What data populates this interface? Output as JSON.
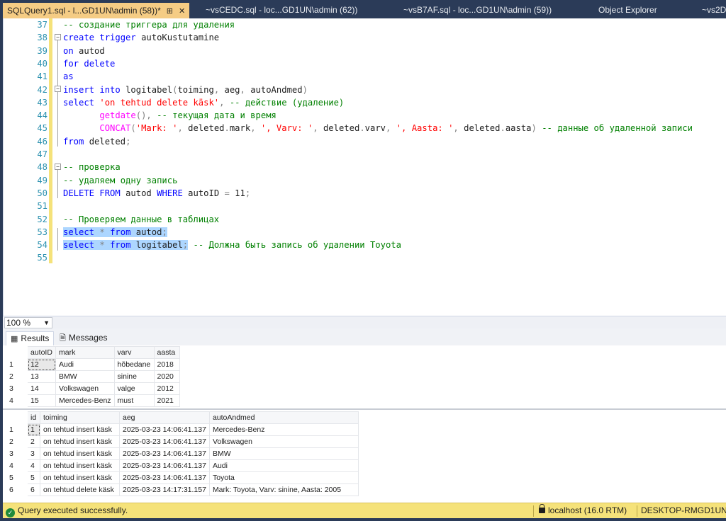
{
  "tabs": [
    {
      "label": "SQLQuery1.sql - l...GD1UN\\admin (58))*",
      "active": true
    },
    {
      "label": "~vsCEDC.sql - loc...GD1UN\\admin (62))"
    },
    {
      "label": "~vsB7AF.sql - loc...GD1UN\\admin (59))"
    },
    {
      "label": "Object Explorer"
    },
    {
      "label": "~vs2D"
    }
  ],
  "tab_icons": {
    "pin": "⊞",
    "close": "✕"
  },
  "editor": {
    "lines": [
      {
        "n": "37",
        "segs": [
          [
            "cm",
            "-- создание триггера для удаления"
          ]
        ]
      },
      {
        "n": "38",
        "segs": [
          [
            "kw",
            "create"
          ],
          [
            "tx",
            " "
          ],
          [
            "kw",
            "trigger"
          ],
          [
            "tx",
            " autoKustutamine"
          ]
        ]
      },
      {
        "n": "39",
        "segs": [
          [
            "kw",
            "on"
          ],
          [
            "tx",
            " autod"
          ]
        ]
      },
      {
        "n": "40",
        "segs": [
          [
            "kw",
            "for"
          ],
          [
            "tx",
            " "
          ],
          [
            "kw",
            "delete"
          ]
        ]
      },
      {
        "n": "41",
        "segs": [
          [
            "kw",
            "as"
          ]
        ]
      },
      {
        "n": "42",
        "segs": [
          [
            "kw",
            "insert"
          ],
          [
            "tx",
            " "
          ],
          [
            "kw",
            "into"
          ],
          [
            "tx",
            " logitabel"
          ],
          [
            "gr",
            "("
          ],
          [
            "tx",
            "toiming"
          ],
          [
            "gr",
            ","
          ],
          [
            "tx",
            " aeg"
          ],
          [
            "gr",
            ","
          ],
          [
            "tx",
            " autoAndmed"
          ],
          [
            "gr",
            ")"
          ]
        ]
      },
      {
        "n": "43",
        "segs": [
          [
            "kw",
            "select"
          ],
          [
            "tx",
            " "
          ],
          [
            "str",
            "'on tehtud delete käsk'"
          ],
          [
            "gr",
            ","
          ],
          [
            "tx",
            " "
          ],
          [
            "cm",
            "-- действие (удаление)"
          ]
        ]
      },
      {
        "n": "44",
        "segs": [
          [
            "tx",
            "       "
          ],
          [
            "fn",
            "getdate"
          ],
          [
            "gr",
            "(),"
          ],
          [
            "tx",
            " "
          ],
          [
            "cm",
            "-- текущая дата и время"
          ]
        ]
      },
      {
        "n": "45",
        "segs": [
          [
            "tx",
            "       "
          ],
          [
            "fn",
            "CONCAT"
          ],
          [
            "gr",
            "("
          ],
          [
            "str",
            "'Mark: '"
          ],
          [
            "gr",
            ","
          ],
          [
            "tx",
            " deleted"
          ],
          [
            "gr",
            "."
          ],
          [
            "tx",
            "mark"
          ],
          [
            "gr",
            ","
          ],
          [
            "tx",
            " "
          ],
          [
            "str",
            "', Varv: '"
          ],
          [
            "gr",
            ","
          ],
          [
            "tx",
            " deleted"
          ],
          [
            "gr",
            "."
          ],
          [
            "tx",
            "varv"
          ],
          [
            "gr",
            ","
          ],
          [
            "tx",
            " "
          ],
          [
            "str",
            "', Aasta: '"
          ],
          [
            "gr",
            ","
          ],
          [
            "tx",
            " deleted"
          ],
          [
            "gr",
            "."
          ],
          [
            "tx",
            "aasta"
          ],
          [
            "gr",
            ")"
          ],
          [
            "tx",
            " "
          ],
          [
            "cm",
            "-- данные об удаленной записи"
          ]
        ]
      },
      {
        "n": "46",
        "segs": [
          [
            "kw",
            "from"
          ],
          [
            "tx",
            " deleted"
          ],
          [
            "gr",
            ";"
          ]
        ]
      },
      {
        "n": "47",
        "segs": []
      },
      {
        "n": "48",
        "segs": [
          [
            "cm",
            "-- проверка"
          ]
        ]
      },
      {
        "n": "49",
        "segs": [
          [
            "cm",
            "-- удаляем одну запись"
          ]
        ]
      },
      {
        "n": "50",
        "segs": [
          [
            "kw",
            "DELETE"
          ],
          [
            "tx",
            " "
          ],
          [
            "kw",
            "FROM"
          ],
          [
            "tx",
            " autod "
          ],
          [
            "kw",
            "WHERE"
          ],
          [
            "tx",
            " autoID "
          ],
          [
            "gr",
            "="
          ],
          [
            "tx",
            " 11"
          ],
          [
            "gr",
            ";"
          ]
        ]
      },
      {
        "n": "51",
        "segs": []
      },
      {
        "n": "52",
        "segs": [
          [
            "cm",
            "-- Проверяем данные в таблицах"
          ]
        ]
      },
      {
        "n": "53",
        "segs": [
          [
            "kw",
            "select"
          ],
          [
            "tx",
            " "
          ],
          [
            "gr",
            "*"
          ],
          [
            "tx",
            " "
          ],
          [
            "kw",
            "from"
          ],
          [
            "tx",
            " autod"
          ],
          [
            "gr",
            ";"
          ]
        ],
        "sel": true
      },
      {
        "n": "54",
        "segs": [
          [
            "kw",
            "select"
          ],
          [
            "tx",
            " "
          ],
          [
            "gr",
            "*"
          ],
          [
            "tx",
            " "
          ],
          [
            "kw",
            "from"
          ],
          [
            "tx",
            " logitabel"
          ],
          [
            "gr",
            ";"
          ]
        ],
        "sel": true,
        "tail": [
          [
            "tx",
            " "
          ],
          [
            "cm",
            "-- Должна быть запись об удалении Toyota"
          ]
        ]
      },
      {
        "n": "55",
        "segs": []
      }
    ]
  },
  "zoom": {
    "value": "100 %"
  },
  "results_tabs": {
    "results": "Results",
    "messages": "Messages"
  },
  "grid1": {
    "columns": [
      "autoID",
      "mark",
      "varv",
      "aasta"
    ],
    "rows": [
      [
        "1",
        "12",
        "Audi",
        "hõbedane",
        "2018"
      ],
      [
        "2",
        "13",
        "BMW",
        "sinine",
        "2020"
      ],
      [
        "3",
        "14",
        "Volkswagen",
        "valge",
        "2012"
      ],
      [
        "4",
        "15",
        "Mercedes-Benz",
        "must",
        "2021"
      ]
    ]
  },
  "grid2": {
    "columns": [
      "id",
      "toiming",
      "aeg",
      "autoAndmed"
    ],
    "rows": [
      [
        "1",
        "1",
        "on tehtud insert käsk",
        "2025-03-23 14:06:41.137",
        "Mercedes-Benz"
      ],
      [
        "2",
        "2",
        "on tehtud insert käsk",
        "2025-03-23 14:06:41.137",
        "Volkswagen"
      ],
      [
        "3",
        "3",
        "on tehtud insert käsk",
        "2025-03-23 14:06:41.137",
        "BMW"
      ],
      [
        "4",
        "4",
        "on tehtud insert käsk",
        "2025-03-23 14:06:41.137",
        "Audi"
      ],
      [
        "5",
        "5",
        "on tehtud insert käsk",
        "2025-03-23 14:06:41.137",
        "Toyota"
      ],
      [
        "6",
        "6",
        "on tehtud delete käsk",
        "2025-03-23 14:17:31.157",
        "Mark: Toyota, Varv: sinine, Aasta: 2005"
      ]
    ]
  },
  "status": {
    "message": "Query executed successfully.",
    "server": "localhost (16.0 RTM)",
    "machine": "DESKTOP-RMGD1UN"
  },
  "colors": {
    "status_bar": "#f5e27a",
    "active_tab": "#f5cc84",
    "chrome": "#2b3b58"
  }
}
